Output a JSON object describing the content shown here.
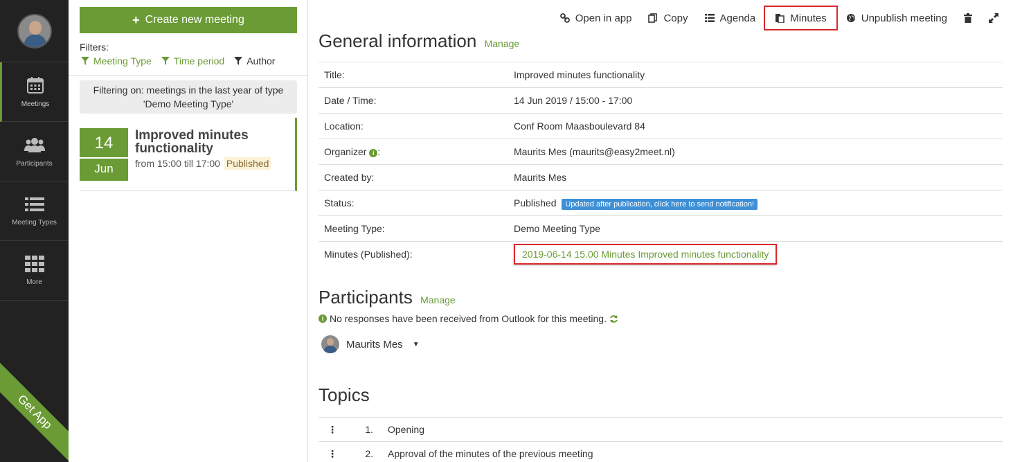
{
  "nav": {
    "items": [
      {
        "label": "Meetings",
        "icon": "calendar-icon"
      },
      {
        "label": "Participants",
        "icon": "users-icon"
      },
      {
        "label": "Meeting Types",
        "icon": "list-icon"
      },
      {
        "label": "More",
        "icon": "grid-icon"
      }
    ],
    "get_app": "Get App"
  },
  "list": {
    "create_label": "Create new meeting",
    "filters_label": "Filters:",
    "filters": [
      "Meeting Type",
      "Time period",
      "Author"
    ],
    "filter_info": "Filtering on: meetings in the last year of type 'Demo Meeting Type'",
    "meeting": {
      "day": "14",
      "month": "Jun",
      "title": "Improved minutes functionality",
      "time": "from 15:00 till 17:00",
      "status": "Published"
    }
  },
  "toolbar": {
    "open_in_app": "Open in app",
    "copy": "Copy",
    "agenda": "Agenda",
    "minutes": "Minutes",
    "unpublish": "Unpublish meeting"
  },
  "general": {
    "heading": "General information",
    "manage": "Manage",
    "rows": {
      "title_label": "Title:",
      "title_value": "Improved minutes functionality",
      "date_label": "Date / Time:",
      "date_value": "14 Jun 2019 / 15:00 - 17:00",
      "location_label": "Location:",
      "location_value": "Conf Room Maasboulevard 84",
      "organizer_label": "Organizer",
      "organizer_colon": ":",
      "organizer_value": "Maurits Mes (maurits@easy2meet.nl)",
      "created_label": "Created by:",
      "created_value": "Maurits Mes",
      "status_label": "Status:",
      "status_value": "Published",
      "status_badge": "Updated after publication, click here to send notification!",
      "type_label": "Meeting Type:",
      "type_value": "Demo Meeting Type",
      "minutes_label": "Minutes (Published):",
      "minutes_value": "2019-06-14 15.00 Minutes Improved minutes functionality"
    }
  },
  "participants": {
    "heading": "Participants",
    "manage": "Manage",
    "notice": "No responses have been received from Outlook for this meeting.",
    "person": "Maurits Mes"
  },
  "topics": {
    "heading": "Topics",
    "items": [
      {
        "num": "1.",
        "label": "Opening"
      },
      {
        "num": "2.",
        "label": "Approval of the minutes of the previous meeting"
      }
    ]
  },
  "colors": {
    "accent": "#6a9b35",
    "highlight": "#d9262b",
    "badge": "#3d8fd6"
  }
}
